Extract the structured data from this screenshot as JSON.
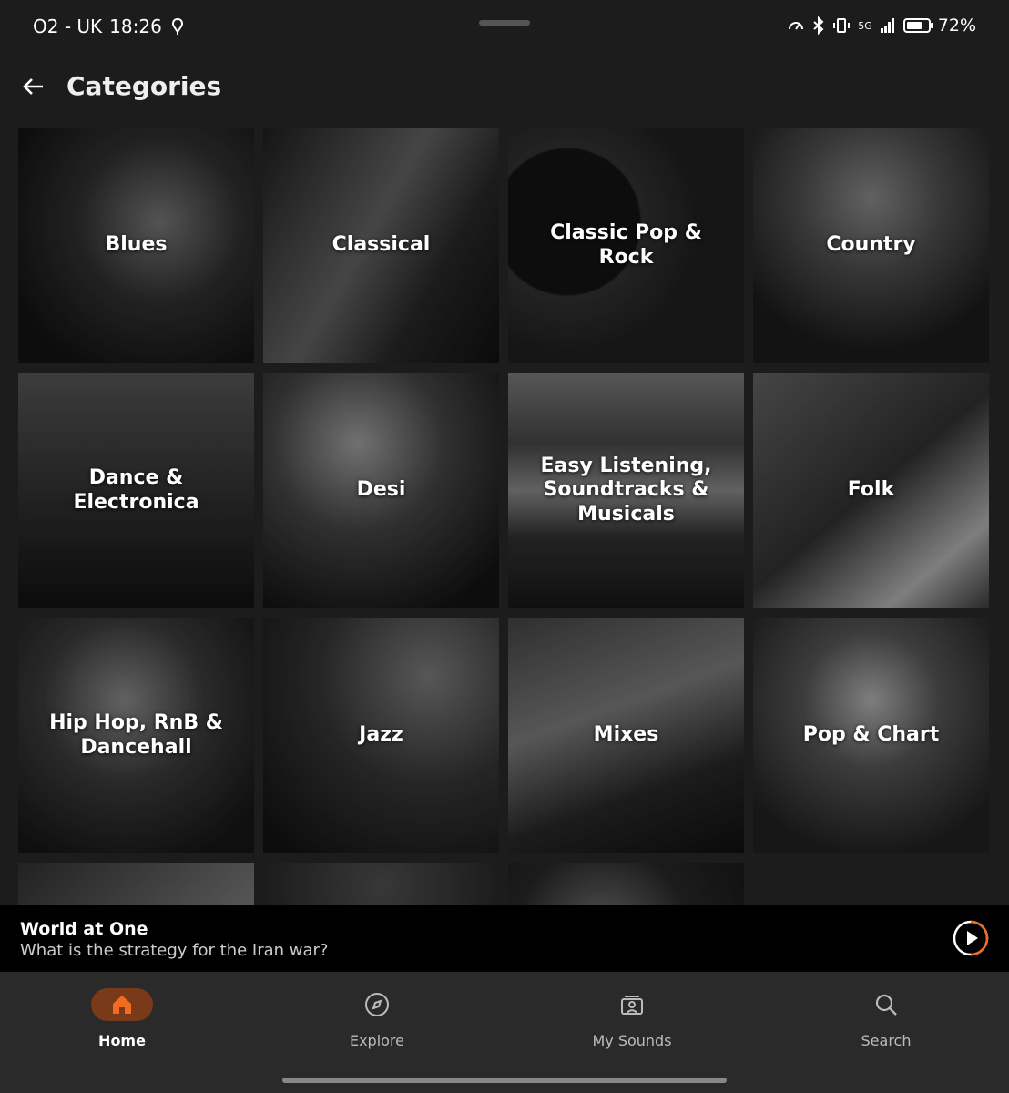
{
  "status_bar": {
    "carrier": "O2 - UK",
    "time": "18:26",
    "network": "5G",
    "battery": "72%",
    "battery_level": 0.72
  },
  "header": {
    "title": "Categories"
  },
  "categories": [
    {
      "label": "Blues"
    },
    {
      "label": "Classical"
    },
    {
      "label": "Classic Pop & Rock"
    },
    {
      "label": "Country"
    },
    {
      "label": "Dance & Electronica"
    },
    {
      "label": "Desi"
    },
    {
      "label": "Easy Listening, Soundtracks & Musicals"
    },
    {
      "label": "Folk"
    },
    {
      "label": "Hip Hop, RnB & Dancehall"
    },
    {
      "label": "Jazz"
    },
    {
      "label": "Mixes"
    },
    {
      "label": "Pop & Chart"
    },
    {
      "label": ""
    },
    {
      "label": ""
    },
    {
      "label": ""
    }
  ],
  "now_playing": {
    "title": "World at One",
    "subtitle": "What is the strategy for the Iran war?"
  },
  "nav": {
    "home": "Home",
    "explore": "Explore",
    "my_sounds": "My Sounds",
    "search": "Search"
  },
  "colors": {
    "accent": "#f26b21",
    "active_pill": "#7a3a1a"
  }
}
